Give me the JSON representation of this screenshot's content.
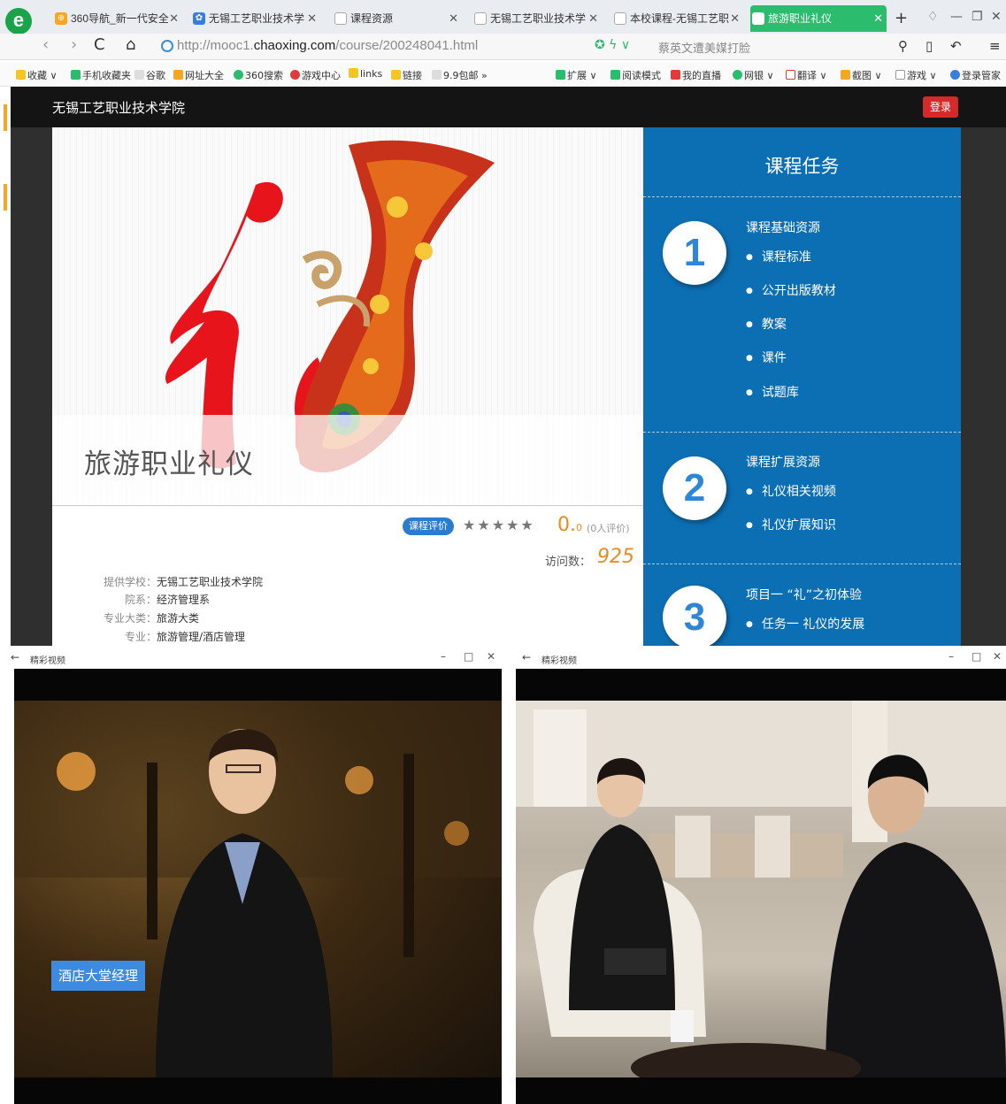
{
  "browser": {
    "tabs": [
      {
        "label": "360导航_新一代安全",
        "icon_color": "#f5a623"
      },
      {
        "label": "无锡工艺职业技术学",
        "icon_color": "#3b7ddd"
      },
      {
        "label": "课程资源",
        "icon_color": "#bbbbbb"
      },
      {
        "label": "无锡工艺职业技术学",
        "icon_color": "#bbbbbb"
      },
      {
        "label": "本校课程-无锡工艺职",
        "icon_color": "#bbbbbb"
      },
      {
        "label": "旅游职业礼仪",
        "icon_color": "#ffffff"
      }
    ],
    "url_prefix": "http://mooc1.",
    "url_domain": "chaoxing.com",
    "url_path": "/course/200248041.html",
    "search_hint": "蔡英文遭美媒打脸",
    "bookmarks_left": [
      "收藏",
      "手机收藏夹",
      "谷歌",
      "网址大全",
      "360搜索",
      "游戏中心",
      "links",
      "链接",
      "9.9包邮"
    ],
    "bookmarks_right": [
      "扩展",
      "阅读模式",
      "我的直播",
      "网银",
      "翻译",
      "截图",
      "游戏",
      "登录管家"
    ]
  },
  "site": {
    "school_name": "无锡工艺职业技术学院",
    "login_label": "登录"
  },
  "course": {
    "title": "旅游职业礼仪",
    "rating_badge": "课程评价",
    "stars": "★★★★★",
    "score_main": "0.",
    "score_decimal": "0",
    "review_count": "(0人评价)",
    "visits_label": "访问数：",
    "visits": "925",
    "info": [
      {
        "key": "提供学校：",
        "value": "无锡工艺职业技术学院"
      },
      {
        "key": "院系：",
        "value": "经济管理系"
      },
      {
        "key": "专业大类：",
        "value": "旅游大类"
      },
      {
        "key": "专业：",
        "value": "旅游管理/酒店管理"
      }
    ]
  },
  "tasks": {
    "title": "课程任务",
    "sections": [
      {
        "num": "1",
        "title": "课程基础资源",
        "items": [
          "课程标准",
          "公开出版教材",
          "教案",
          "课件",
          "试题库"
        ]
      },
      {
        "num": "2",
        "title": "课程扩展资源",
        "items": [
          "礼仪相关视频",
          "礼仪扩展知识"
        ]
      },
      {
        "num": "3",
        "title": "项目一 “礼”之初体验",
        "items": [
          "任务一 礼仪的发展"
        ]
      }
    ]
  },
  "videos": {
    "left_title": "精彩视频",
    "right_title": "精彩视频",
    "left_caption": "酒店大堂经理"
  }
}
